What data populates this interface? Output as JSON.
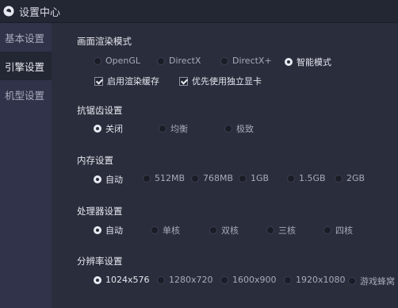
{
  "window": {
    "title": "设置中心"
  },
  "sidebar": {
    "items": [
      {
        "label": "基本设置",
        "active": false
      },
      {
        "label": "引擎设置",
        "active": true
      },
      {
        "label": "机型设置",
        "active": false
      }
    ]
  },
  "render": {
    "title": "画面渲染模式",
    "options": [
      "OpenGL",
      "DirectX",
      "DirectX+",
      "智能模式"
    ],
    "selected": "智能模式",
    "checks": [
      {
        "label": "启用渲染缓存",
        "checked": true
      },
      {
        "label": "优先使用独立显卡",
        "checked": true
      }
    ]
  },
  "antialias": {
    "title": "抗锯齿设置",
    "options": [
      "关闭",
      "均衡",
      "极致"
    ],
    "selected": "关闭"
  },
  "memory": {
    "title": "内存设置",
    "options": [
      "自动",
      "512MB",
      "768MB",
      "1GB",
      "1.5GB",
      "2GB"
    ],
    "selected": "自动"
  },
  "cpu": {
    "title": "处理器设置",
    "options": [
      "自动",
      "单核",
      "双核",
      "三核",
      "四核"
    ],
    "selected": "自动"
  },
  "resolution": {
    "title": "分辨率设置",
    "options": [
      "1024x576",
      "1280x720",
      "1600x900",
      "1920x1080",
      "游戏蜂窝"
    ],
    "selected": "1024x576"
  },
  "colors": {
    "background": "#2a2d3c",
    "sidebar": "#30334a",
    "active_nav": "#232633",
    "accent": "#e8eaf2"
  }
}
